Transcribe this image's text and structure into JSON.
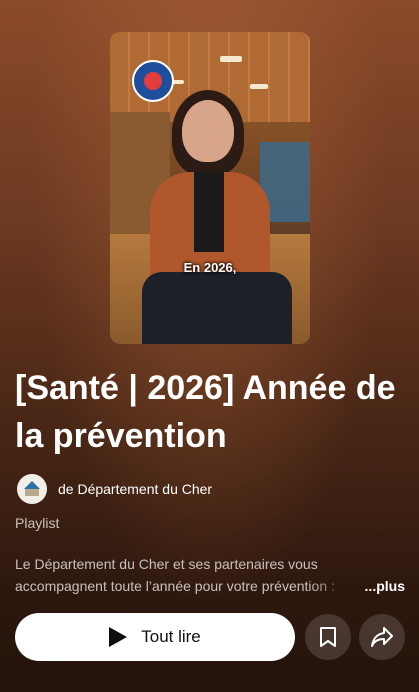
{
  "thumbnail": {
    "caption": "En 2026,"
  },
  "playlist": {
    "title": "[Santé | 2026] Année de la prévention",
    "channel": "de Département du Cher",
    "type": "Playlist",
    "description_line1": "Le Département du Cher et ses partenaires vous",
    "description_line2": "accompagnent toute l’année pour votre prévention :",
    "more_label": "...plus"
  },
  "actions": {
    "play_all_label": "Tout lire",
    "save_icon": "bookmark-icon",
    "share_icon": "share-icon"
  },
  "colors": {
    "play_button_bg": "#ffffff",
    "background_top": "#8a4a2a",
    "background_bottom": "#23130b"
  }
}
